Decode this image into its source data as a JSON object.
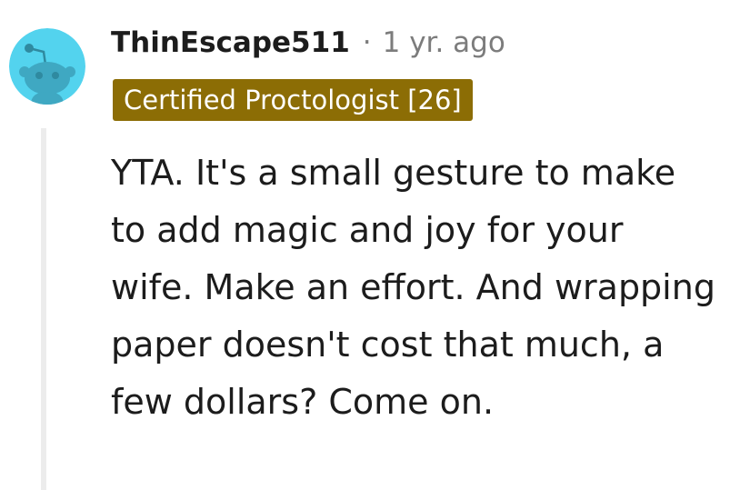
{
  "comment": {
    "avatar_icon": "reddit-snoo-avatar-icon",
    "avatar_color": "#53d3ee",
    "username": "ThinEscape511",
    "separator": "·",
    "timestamp": "1 yr. ago",
    "flair": {
      "text": "Certified Proctologist [26]",
      "background": "#8c6d05",
      "color": "#ffffff"
    },
    "body": "YTA. It's a small gesture to make to add magic and joy for your wife. Make an effort. And wrapping paper doesn't cost that much, a few dollars? Come on."
  }
}
